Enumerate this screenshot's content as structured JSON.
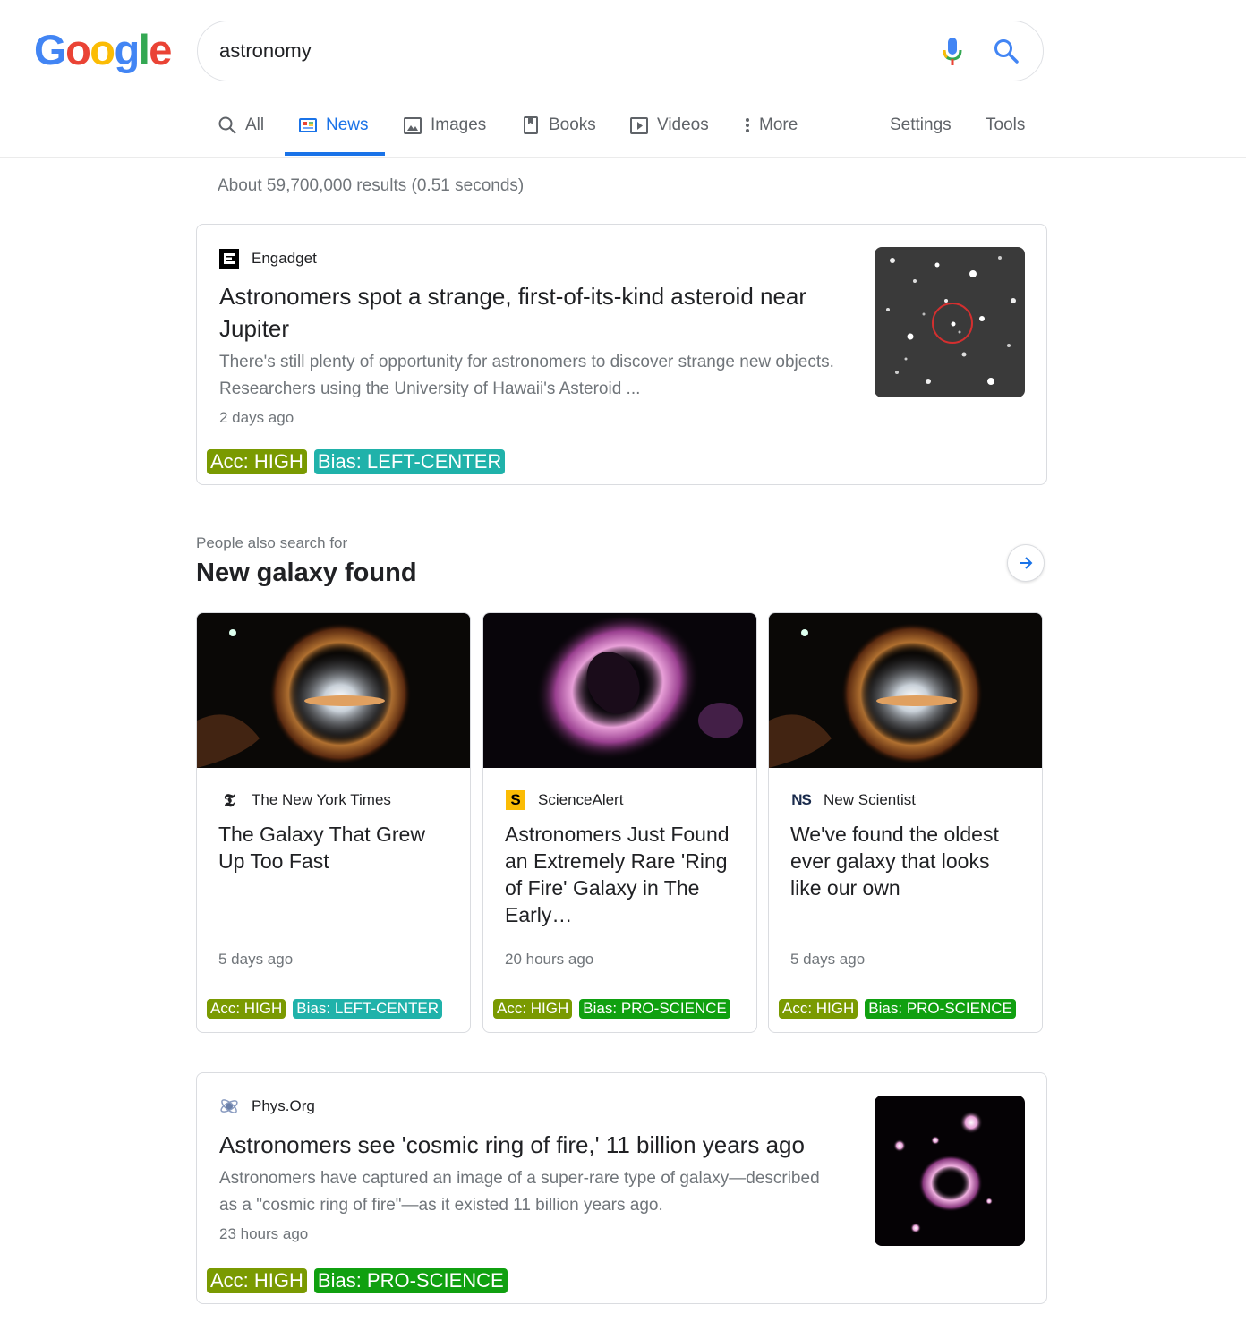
{
  "logo": {
    "text": "Google",
    "letters": [
      "G",
      "o",
      "o",
      "g",
      "l",
      "e"
    ],
    "colors": [
      "#4285f4",
      "#ea4335",
      "#fbbc05",
      "#4285f4",
      "#34a853",
      "#ea4335"
    ]
  },
  "search": {
    "query": "astronomy",
    "mic_icon": "mic-icon",
    "search_icon": "search-icon"
  },
  "tabs": [
    {
      "label": "All",
      "icon": "search-icon",
      "active": false
    },
    {
      "label": "News",
      "icon": "news-icon",
      "active": true
    },
    {
      "label": "Images",
      "icon": "image-icon",
      "active": false
    },
    {
      "label": "Books",
      "icon": "book-icon",
      "active": false
    },
    {
      "label": "Videos",
      "icon": "video-icon",
      "active": false
    },
    {
      "label": "More",
      "icon": "more-icon",
      "active": false
    }
  ],
  "tools": {
    "settings": "Settings",
    "tools": "Tools"
  },
  "stats": "About 59,700,000 results (0.51 seconds)",
  "results": [
    {
      "source": "Engadget",
      "title": "Astronomers spot a strange, first-of-its-kind asteroid near Jupiter",
      "snippet": "There's still plenty of opportunity for astronomers to discover strange new objects. Researchers using the University of Hawaii's Asteroid ...",
      "age": "2 days ago",
      "acc": "Acc: HIGH",
      "bias": "Bias: LEFT-CENTER"
    },
    {
      "source": "Phys.Org",
      "title": "Astronomers see 'cosmic ring of fire,' 11 billion years ago",
      "snippet": "Astronomers have captured an image of a super-rare type of galaxy—described as a \"cosmic ring of fire\"—as it existed 11 billion years ago.",
      "age": "23 hours ago",
      "acc": "Acc: HIGH",
      "bias": "Bias: PRO-SCIENCE"
    }
  ],
  "people_also_search": {
    "label": "People also search for",
    "title": "New galaxy found",
    "cards": [
      {
        "source": "The New York Times",
        "title": "The Galaxy That Grew Up Too Fast",
        "age": "5 days ago",
        "acc": "Acc: HIGH",
        "bias": "Bias: LEFT-CENTER"
      },
      {
        "source": "ScienceAlert",
        "title": "Astronomers Just Found an Extremely Rare 'Ring of Fire' Galaxy in The Early…",
        "age": "20 hours ago",
        "acc": "Acc: HIGH",
        "bias": "Bias: PRO-SCIENCE"
      },
      {
        "source": "New Scientist",
        "title": "We've found the oldest ever galaxy that looks like our own",
        "age": "5 days ago",
        "acc": "Acc: HIGH",
        "bias": "Bias: PRO-SCIENCE"
      }
    ]
  },
  "colors": {
    "link_blue": "#1a73e8",
    "acc_badge": "#7a9a01",
    "bias_left_center": "#20b2aa",
    "bias_pro_science": "#10a010"
  }
}
